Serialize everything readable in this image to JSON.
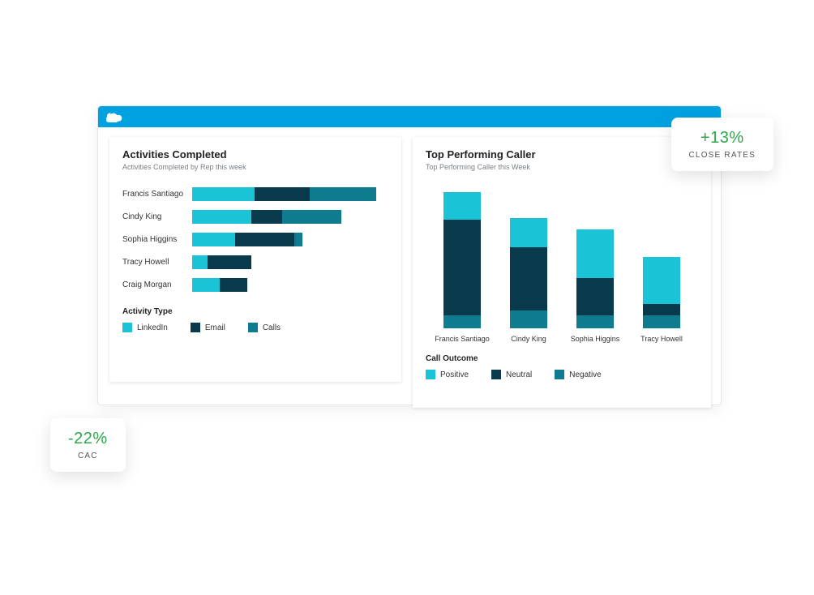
{
  "colors": {
    "light": "#1ac4d6",
    "dark": "#083a4b",
    "mid": "#0e7c8e",
    "brand": "#00a1e0",
    "positive_text": "#2aa84a"
  },
  "activities": {
    "title": "Activities Completed",
    "subtitle": "Activities Completed by Rep this week",
    "legend_title": "Activity Type",
    "legend": [
      "LinkedIn",
      "Email",
      "Calls"
    ]
  },
  "callers": {
    "title": "Top Performing Caller",
    "subtitle": "Top Performing Caller this Week",
    "legend_title": "Call Outcome",
    "legend": [
      "Positive",
      "Neutral",
      "Negative"
    ]
  },
  "badges": {
    "close_rates": {
      "value": "+13%",
      "label": "CLOSE RATES"
    },
    "cac": {
      "value": "-22%",
      "label": "CAC"
    }
  },
  "chart_data": [
    {
      "type": "bar",
      "orientation": "horizontal",
      "stacked": true,
      "title": "Activities Completed",
      "subtitle": "Activities Completed by Rep this week",
      "categories": [
        "Francis Santiago",
        "Cindy King",
        "Sophia Higgins",
        "Tracy Howell",
        "Craig Morgan"
      ],
      "series": [
        {
          "name": "LinkedIn",
          "color": "#1ac4d6",
          "values": [
            32,
            30,
            22,
            8,
            14
          ]
        },
        {
          "name": "Email",
          "color": "#083a4b",
          "values": [
            28,
            16,
            30,
            22,
            14
          ]
        },
        {
          "name": "Calls",
          "color": "#0e7c8e",
          "values": [
            34,
            30,
            4,
            0,
            0
          ]
        }
      ],
      "xlim": [
        0,
        100
      ]
    },
    {
      "type": "bar",
      "orientation": "vertical",
      "stacked": true,
      "title": "Top Performing Caller",
      "subtitle": "Top Performing Caller this Week",
      "categories": [
        "Francis Santiago",
        "Cindy King",
        "Sophia Higgins",
        "Tracy Howell"
      ],
      "series": [
        {
          "name": "Positive",
          "color": "#1ac4d6",
          "values": [
            34,
            36,
            60,
            58
          ]
        },
        {
          "name": "Neutral",
          "color": "#083a4b",
          "values": [
            118,
            78,
            46,
            14
          ]
        },
        {
          "name": "Negative",
          "color": "#0e7c8e",
          "values": [
            16,
            22,
            16,
            16
          ]
        }
      ],
      "ylim": [
        0,
        180
      ]
    }
  ]
}
